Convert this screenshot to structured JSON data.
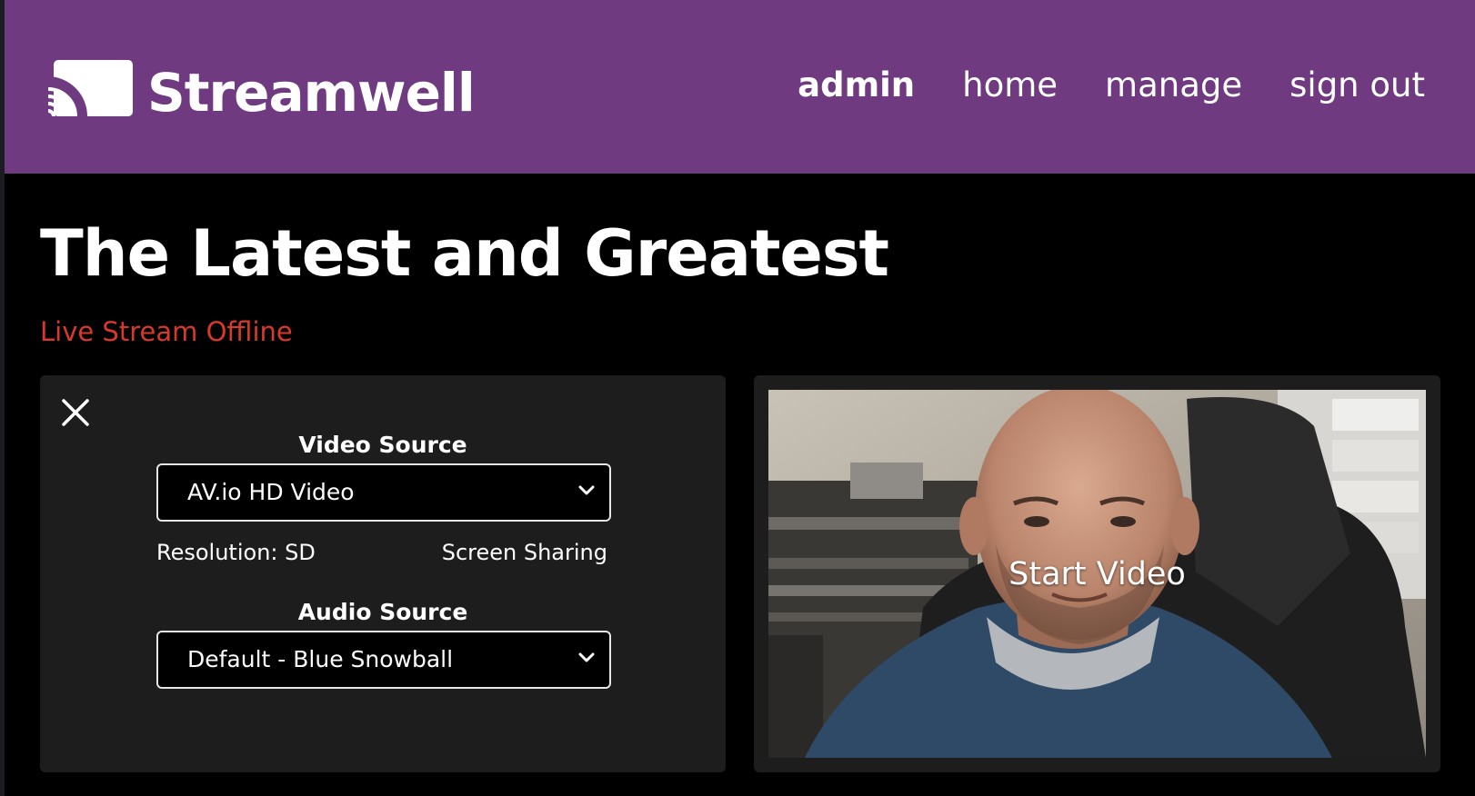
{
  "brand": {
    "name": "Streamwell",
    "icon": "cast-icon",
    "header_color": "#6f3a80"
  },
  "nav": {
    "items": [
      {
        "label": "admin",
        "active": true
      },
      {
        "label": "home",
        "active": false
      },
      {
        "label": "manage",
        "active": false
      },
      {
        "label": "sign out",
        "active": false
      }
    ]
  },
  "page": {
    "title": "The Latest and Greatest",
    "status": "Live Stream Offline",
    "status_color": "#d8392b"
  },
  "settings": {
    "close_icon": "close-icon",
    "video_source": {
      "label": "Video Source",
      "selected": "AV.io HD Video",
      "resolution": "Resolution: SD",
      "screen_sharing": "Screen Sharing"
    },
    "audio_source": {
      "label": "Audio Source",
      "selected": "Default - Blue Snowball"
    }
  },
  "preview": {
    "overlay_label": "Start Video"
  }
}
